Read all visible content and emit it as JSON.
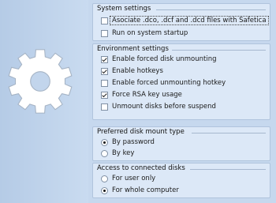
{
  "system_settings": {
    "title": "System settings",
    "options": [
      {
        "label": "Asociate .dco, .dcf and .dcd files with Safetica",
        "checked": false
      },
      {
        "label": "Run on system startup",
        "checked": false
      }
    ]
  },
  "environment_settings": {
    "title": "Environment settings",
    "options": [
      {
        "label": "Enable forced disk unmounting",
        "checked": true
      },
      {
        "label": "Enable hotkeys",
        "checked": true
      },
      {
        "label": "Enable forced unmounting hotkey",
        "checked": false
      },
      {
        "label": "Force RSA key usage",
        "checked": true
      },
      {
        "label": "Unmount disks before suspend",
        "checked": false
      }
    ]
  },
  "disk_mount_type": {
    "title": "Preferred disk mount type",
    "options": [
      {
        "label": "By password",
        "selected": true
      },
      {
        "label": "By key",
        "selected": false
      }
    ]
  },
  "disk_access": {
    "title": "Access to connected disks",
    "options": [
      {
        "label": "For user only",
        "selected": false
      },
      {
        "label": "For whole computer",
        "selected": true
      }
    ]
  }
}
